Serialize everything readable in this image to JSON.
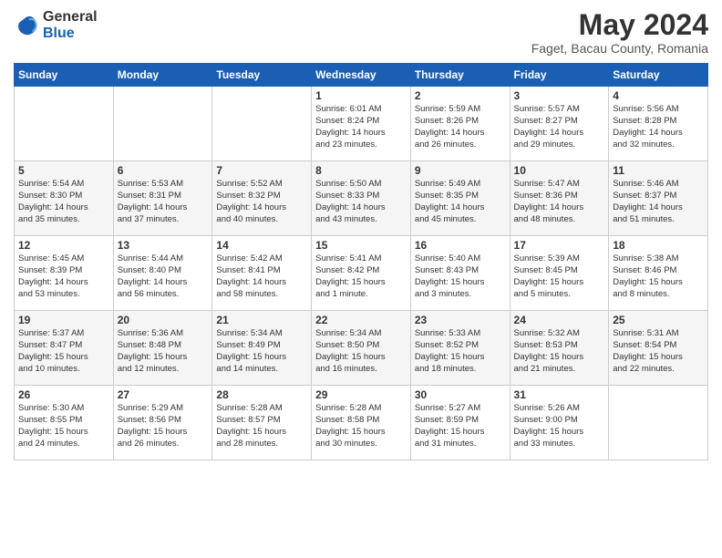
{
  "logo": {
    "general": "General",
    "blue": "Blue"
  },
  "header": {
    "month_year": "May 2024",
    "location": "Faget, Bacau County, Romania"
  },
  "weekdays": [
    "Sunday",
    "Monday",
    "Tuesday",
    "Wednesday",
    "Thursday",
    "Friday",
    "Saturday"
  ],
  "weeks": [
    [
      {
        "day": "",
        "text": ""
      },
      {
        "day": "",
        "text": ""
      },
      {
        "day": "",
        "text": ""
      },
      {
        "day": "1",
        "text": "Sunrise: 6:01 AM\nSunset: 8:24 PM\nDaylight: 14 hours\nand 23 minutes."
      },
      {
        "day": "2",
        "text": "Sunrise: 5:59 AM\nSunset: 8:26 PM\nDaylight: 14 hours\nand 26 minutes."
      },
      {
        "day": "3",
        "text": "Sunrise: 5:57 AM\nSunset: 8:27 PM\nDaylight: 14 hours\nand 29 minutes."
      },
      {
        "day": "4",
        "text": "Sunrise: 5:56 AM\nSunset: 8:28 PM\nDaylight: 14 hours\nand 32 minutes."
      }
    ],
    [
      {
        "day": "5",
        "text": "Sunrise: 5:54 AM\nSunset: 8:30 PM\nDaylight: 14 hours\nand 35 minutes."
      },
      {
        "day": "6",
        "text": "Sunrise: 5:53 AM\nSunset: 8:31 PM\nDaylight: 14 hours\nand 37 minutes."
      },
      {
        "day": "7",
        "text": "Sunrise: 5:52 AM\nSunset: 8:32 PM\nDaylight: 14 hours\nand 40 minutes."
      },
      {
        "day": "8",
        "text": "Sunrise: 5:50 AM\nSunset: 8:33 PM\nDaylight: 14 hours\nand 43 minutes."
      },
      {
        "day": "9",
        "text": "Sunrise: 5:49 AM\nSunset: 8:35 PM\nDaylight: 14 hours\nand 45 minutes."
      },
      {
        "day": "10",
        "text": "Sunrise: 5:47 AM\nSunset: 8:36 PM\nDaylight: 14 hours\nand 48 minutes."
      },
      {
        "day": "11",
        "text": "Sunrise: 5:46 AM\nSunset: 8:37 PM\nDaylight: 14 hours\nand 51 minutes."
      }
    ],
    [
      {
        "day": "12",
        "text": "Sunrise: 5:45 AM\nSunset: 8:39 PM\nDaylight: 14 hours\nand 53 minutes."
      },
      {
        "day": "13",
        "text": "Sunrise: 5:44 AM\nSunset: 8:40 PM\nDaylight: 14 hours\nand 56 minutes."
      },
      {
        "day": "14",
        "text": "Sunrise: 5:42 AM\nSunset: 8:41 PM\nDaylight: 14 hours\nand 58 minutes."
      },
      {
        "day": "15",
        "text": "Sunrise: 5:41 AM\nSunset: 8:42 PM\nDaylight: 15 hours\nand 1 minute."
      },
      {
        "day": "16",
        "text": "Sunrise: 5:40 AM\nSunset: 8:43 PM\nDaylight: 15 hours\nand 3 minutes."
      },
      {
        "day": "17",
        "text": "Sunrise: 5:39 AM\nSunset: 8:45 PM\nDaylight: 15 hours\nand 5 minutes."
      },
      {
        "day": "18",
        "text": "Sunrise: 5:38 AM\nSunset: 8:46 PM\nDaylight: 15 hours\nand 8 minutes."
      }
    ],
    [
      {
        "day": "19",
        "text": "Sunrise: 5:37 AM\nSunset: 8:47 PM\nDaylight: 15 hours\nand 10 minutes."
      },
      {
        "day": "20",
        "text": "Sunrise: 5:36 AM\nSunset: 8:48 PM\nDaylight: 15 hours\nand 12 minutes."
      },
      {
        "day": "21",
        "text": "Sunrise: 5:34 AM\nSunset: 8:49 PM\nDaylight: 15 hours\nand 14 minutes."
      },
      {
        "day": "22",
        "text": "Sunrise: 5:34 AM\nSunset: 8:50 PM\nDaylight: 15 hours\nand 16 minutes."
      },
      {
        "day": "23",
        "text": "Sunrise: 5:33 AM\nSunset: 8:52 PM\nDaylight: 15 hours\nand 18 minutes."
      },
      {
        "day": "24",
        "text": "Sunrise: 5:32 AM\nSunset: 8:53 PM\nDaylight: 15 hours\nand 21 minutes."
      },
      {
        "day": "25",
        "text": "Sunrise: 5:31 AM\nSunset: 8:54 PM\nDaylight: 15 hours\nand 22 minutes."
      }
    ],
    [
      {
        "day": "26",
        "text": "Sunrise: 5:30 AM\nSunset: 8:55 PM\nDaylight: 15 hours\nand 24 minutes."
      },
      {
        "day": "27",
        "text": "Sunrise: 5:29 AM\nSunset: 8:56 PM\nDaylight: 15 hours\nand 26 minutes."
      },
      {
        "day": "28",
        "text": "Sunrise: 5:28 AM\nSunset: 8:57 PM\nDaylight: 15 hours\nand 28 minutes."
      },
      {
        "day": "29",
        "text": "Sunrise: 5:28 AM\nSunset: 8:58 PM\nDaylight: 15 hours\nand 30 minutes."
      },
      {
        "day": "30",
        "text": "Sunrise: 5:27 AM\nSunset: 8:59 PM\nDaylight: 15 hours\nand 31 minutes."
      },
      {
        "day": "31",
        "text": "Sunrise: 5:26 AM\nSunset: 9:00 PM\nDaylight: 15 hours\nand 33 minutes."
      },
      {
        "day": "",
        "text": ""
      }
    ]
  ]
}
